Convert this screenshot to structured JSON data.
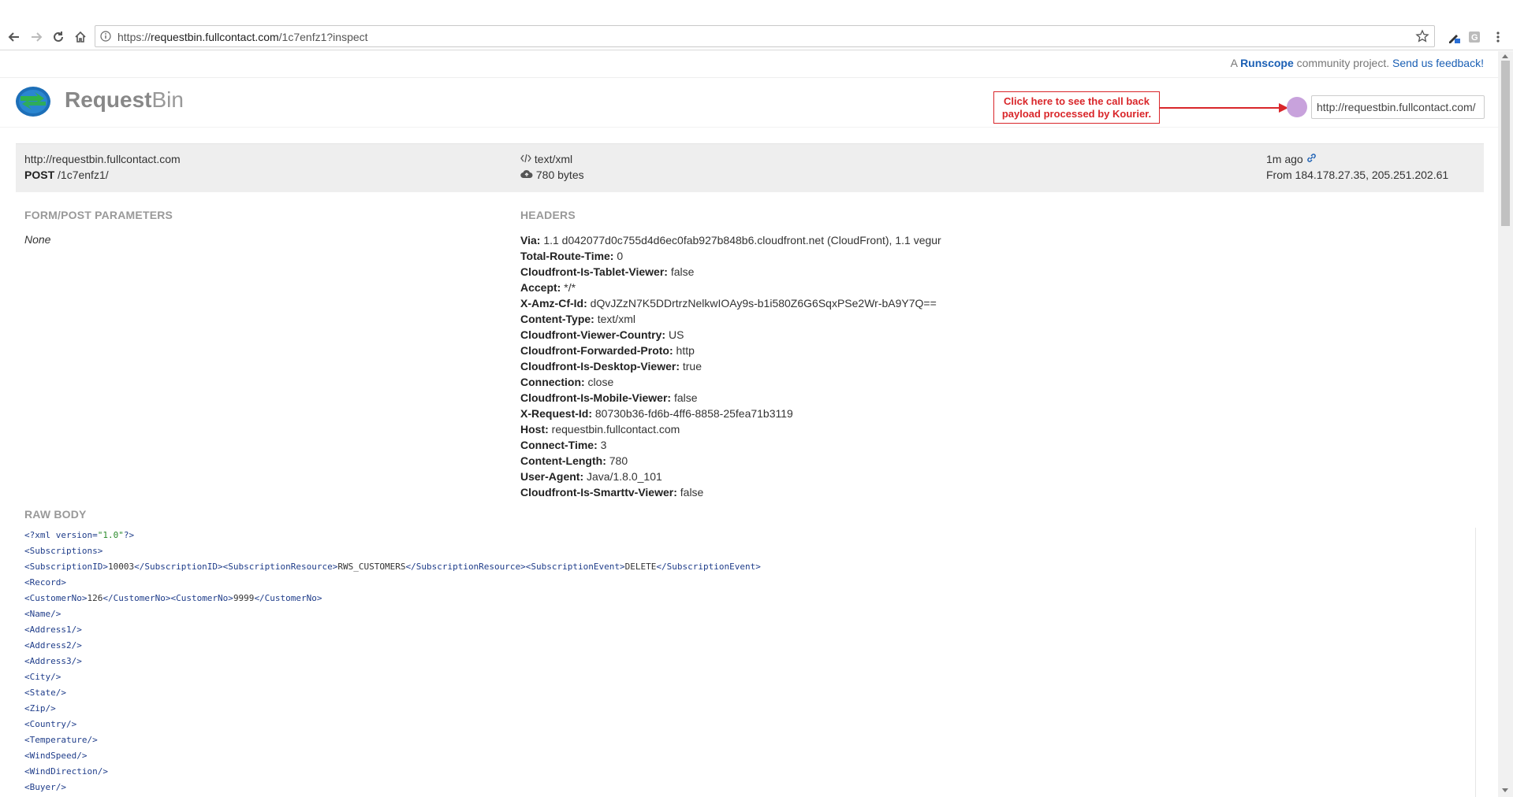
{
  "browser": {
    "url_prefix": "https://",
    "url_host": "requestbin.fullcontact.com",
    "url_path": "/1c7enfz1?inspect"
  },
  "topbar": {
    "prefix": "A",
    "runscope": "Runscope",
    "community": "community project.",
    "feedback": "Send us feedback!"
  },
  "brand": {
    "bold": "Request",
    "light": "Bin"
  },
  "callout": {
    "text": "Click here to see the call back payload processed by Kourier."
  },
  "bin_url": "http://requestbin.fullcontact.com/",
  "summary": {
    "host": "http://requestbin.fullcontact.com",
    "method": "POST",
    "path": "/1c7enfz1/",
    "content_type": "text/xml",
    "size": "780 bytes",
    "time": "1m ago",
    "from": "From 184.178.27.35, 205.251.202.61"
  },
  "sections": {
    "form": "FORM/POST PARAMETERS",
    "form_value": "None",
    "headers": "HEADERS",
    "raw": "RAW BODY"
  },
  "headers": [
    {
      "key": "Via:",
      "value": "1.1 d042077d0c755d4d6ec0fab927b848b6.cloudfront.net (CloudFront), 1.1 vegur"
    },
    {
      "key": "Total-Route-Time:",
      "value": "0"
    },
    {
      "key": "Cloudfront-Is-Tablet-Viewer:",
      "value": "false"
    },
    {
      "key": "Accept:",
      "value": "*/*"
    },
    {
      "key": "X-Amz-Cf-Id:",
      "value": "dQvJZzN7K5DDrtrzNelkwIOAy9s-b1i580Z6G6SqxPSe2Wr-bA9Y7Q=="
    },
    {
      "key": "Content-Type:",
      "value": "text/xml"
    },
    {
      "key": "Cloudfront-Viewer-Country:",
      "value": "US"
    },
    {
      "key": "Cloudfront-Forwarded-Proto:",
      "value": "http"
    },
    {
      "key": "Cloudfront-Is-Desktop-Viewer:",
      "value": "true"
    },
    {
      "key": "Connection:",
      "value": "close"
    },
    {
      "key": "Cloudfront-Is-Mobile-Viewer:",
      "value": "false"
    },
    {
      "key": "X-Request-Id:",
      "value": "80730b36-fd6b-4ff6-8858-25fea71b3119"
    },
    {
      "key": "Host:",
      "value": "requestbin.fullcontact.com"
    },
    {
      "key": "Connect-Time:",
      "value": "3"
    },
    {
      "key": "Content-Length:",
      "value": "780"
    },
    {
      "key": "User-Agent:",
      "value": "Java/1.8.0_101"
    },
    {
      "key": "Cloudfront-Is-Smarttv-Viewer:",
      "value": "false"
    }
  ],
  "raw_body": {
    "decl_open": "<?xml version=",
    "decl_value": "\"1.0\"",
    "decl_close": "?>",
    "lines": [
      [
        {
          "t": "tag",
          "v": "<Subscriptions>"
        }
      ],
      [
        {
          "t": "tag",
          "v": "<SubscriptionID>"
        },
        {
          "t": "txt",
          "v": "10003"
        },
        {
          "t": "tag",
          "v": "</SubscriptionID><SubscriptionResource>"
        },
        {
          "t": "txt",
          "v": "RWS_CUSTOMERS"
        },
        {
          "t": "tag",
          "v": "</SubscriptionResource><SubscriptionEvent>"
        },
        {
          "t": "txt",
          "v": "DELETE"
        },
        {
          "t": "tag",
          "v": "</SubscriptionEvent>"
        }
      ],
      [
        {
          "t": "tag",
          "v": "<Record>"
        }
      ],
      [
        {
          "t": "tag",
          "v": "<CustomerNo>"
        },
        {
          "t": "txt",
          "v": "126"
        },
        {
          "t": "tag",
          "v": "</CustomerNo><CustomerNo>"
        },
        {
          "t": "txt",
          "v": "9999"
        },
        {
          "t": "tag",
          "v": "</CustomerNo>"
        }
      ],
      [
        {
          "t": "tag",
          "v": "<Name/>"
        }
      ],
      [
        {
          "t": "tag",
          "v": "<Address1/>"
        }
      ],
      [
        {
          "t": "tag",
          "v": "<Address2/>"
        }
      ],
      [
        {
          "t": "tag",
          "v": "<Address3/>"
        }
      ],
      [
        {
          "t": "tag",
          "v": "<City/>"
        }
      ],
      [
        {
          "t": "tag",
          "v": "<State/>"
        }
      ],
      [
        {
          "t": "tag",
          "v": "<Zip/>"
        }
      ],
      [
        {
          "t": "tag",
          "v": "<Country/>"
        }
      ],
      [
        {
          "t": "tag",
          "v": "<Temperature/>"
        }
      ],
      [
        {
          "t": "tag",
          "v": "<WindSpeed/>"
        }
      ],
      [
        {
          "t": "tag",
          "v": "<WindDirection/>"
        }
      ],
      [
        {
          "t": "tag",
          "v": "<Buyer/>"
        }
      ]
    ]
  },
  "colors": {
    "link": "#1a5fb4",
    "callout": "#d9262a",
    "status_dot": "#c8a2dc",
    "summary_bg": "#eeeeee"
  },
  "icons": [
    "back-arrow-icon",
    "forward-arrow-icon",
    "reload-icon",
    "home-icon",
    "info-icon",
    "star-icon",
    "pen-icon",
    "g-extension-icon",
    "menu-dots-icon",
    "requestbin-logo",
    "code-icon",
    "cloud-upload-icon",
    "link-icon"
  ]
}
